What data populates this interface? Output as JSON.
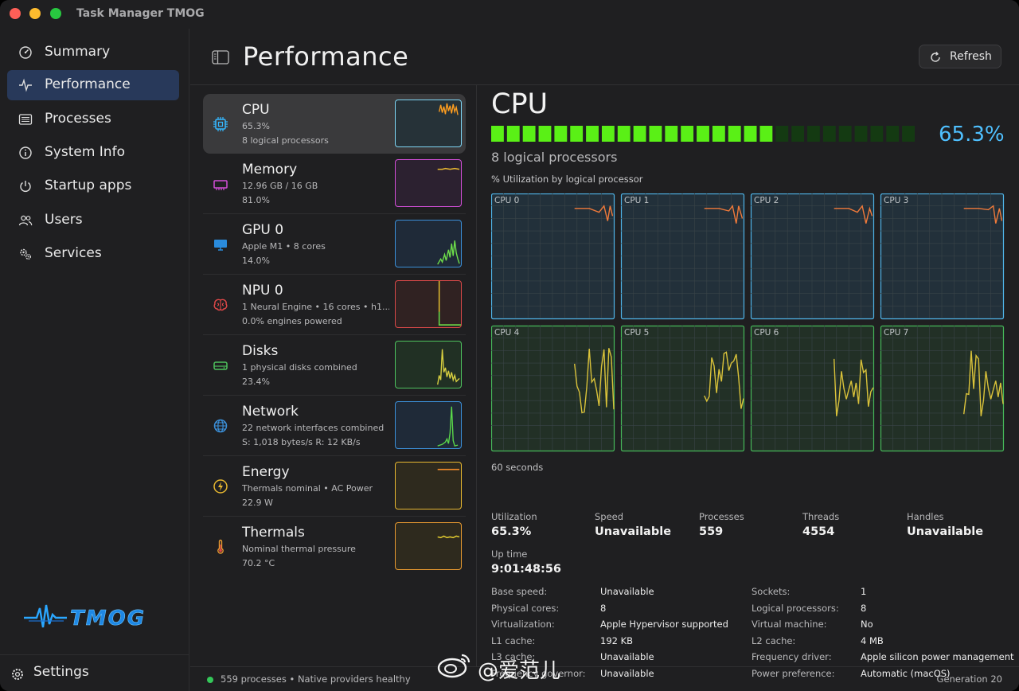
{
  "window": {
    "title": "Task Manager TMOG"
  },
  "sidebar": {
    "items": [
      {
        "label": "Summary",
        "icon": "gauge-icon"
      },
      {
        "label": "Performance",
        "icon": "pulse-icon"
      },
      {
        "label": "Processes",
        "icon": "list-icon"
      },
      {
        "label": "System Info",
        "icon": "info-icon"
      },
      {
        "label": "Startup apps",
        "icon": "power-icon"
      },
      {
        "label": "Users",
        "icon": "users-icon"
      },
      {
        "label": "Services",
        "icon": "gears-icon"
      }
    ],
    "active": "Performance",
    "logo_text": "TMOG",
    "settings_label": "Settings"
  },
  "header": {
    "title": "Performance",
    "refresh_label": "Refresh"
  },
  "resources": [
    {
      "name": "CPU",
      "line1": "65.3%",
      "line2": "8 logical processors",
      "color": "#7fd6f5",
      "icon": "cpu-icon"
    },
    {
      "name": "Memory",
      "line1": "12.96 GB / 16 GB",
      "line2": "81.0%",
      "color": "#d34fd8",
      "icon": "memory-icon"
    },
    {
      "name": "GPU 0",
      "line1": "Apple M1 • 8 cores",
      "line2": "14.0%",
      "color": "#3b8fd8",
      "icon": "monitor-icon"
    },
    {
      "name": "NPU 0",
      "line1": "1 Neural Engine • 16 cores • h1...",
      "line2": "0.0% engines powered",
      "color": "#d84848",
      "icon": "brain-icon"
    },
    {
      "name": "Disks",
      "line1": "1 physical disks combined",
      "line2": "23.4%",
      "color": "#4ec25e",
      "icon": "disk-icon"
    },
    {
      "name": "Network",
      "line1": "22 network interfaces combined",
      "line2": "S: 1,018 bytes/s  R: 12 KB/s",
      "color": "#3b8fd8",
      "icon": "globe-icon"
    },
    {
      "name": "Energy",
      "line1": "Thermals nominal • AC Power",
      "line2": "22.9 W",
      "color": "#e8b830",
      "icon": "bolt-icon"
    },
    {
      "name": "Thermals",
      "line1": "Nominal thermal pressure",
      "line2": "70.2 °C",
      "color": "#e89a30",
      "icon": "thermometer-icon"
    }
  ],
  "detail": {
    "title": "CPU",
    "utilization_fraction": 0.653,
    "percent_text": "65.3%",
    "subtitle": "8 logical processors",
    "graph_label": "% Utilization by logical processor",
    "cores": [
      "CPU 0",
      "CPU 1",
      "CPU 2",
      "CPU 3",
      "CPU 4",
      "CPU 5",
      "CPU 6",
      "CPU 7"
    ],
    "time_window": "60 seconds",
    "stats": [
      {
        "label": "Utilization",
        "value": "65.3%"
      },
      {
        "label": "Speed",
        "value": "Unavailable"
      },
      {
        "label": "Processes",
        "value": "559"
      },
      {
        "label": "Threads",
        "value": "4554"
      },
      {
        "label": "Handles",
        "value": "Unavailable"
      }
    ],
    "uptime_label": "Up time",
    "uptime": "9:01:48:56",
    "specs_left": [
      {
        "k": "Base speed:",
        "v": "Unavailable"
      },
      {
        "k": "Physical cores:",
        "v": "8"
      },
      {
        "k": "Virtualization:",
        "v": "Apple Hypervisor supported"
      },
      {
        "k": "L1 cache:",
        "v": "192 KB"
      },
      {
        "k": "L3 cache:",
        "v": "Unavailable"
      },
      {
        "k": "Frequency governor:",
        "v": "Unavailable"
      }
    ],
    "specs_right": [
      {
        "k": "Sockets:",
        "v": "1"
      },
      {
        "k": "Logical processors:",
        "v": "8"
      },
      {
        "k": "Virtual machine:",
        "v": "No"
      },
      {
        "k": "L2 cache:",
        "v": "4 MB"
      },
      {
        "k": "Frequency driver:",
        "v": "Apple silicon power management"
      },
      {
        "k": "Power preference:",
        "v": "Automatic (macOS)"
      }
    ]
  },
  "status": {
    "text": "559 processes • Native providers healthy",
    "generation": "Generation 20"
  },
  "watermark": "@爱范儿",
  "colors": {
    "accent": "#4fc0ff",
    "bar_on": "#5af016",
    "bar_off": "#143a12",
    "sel_nav": "#28395a"
  }
}
